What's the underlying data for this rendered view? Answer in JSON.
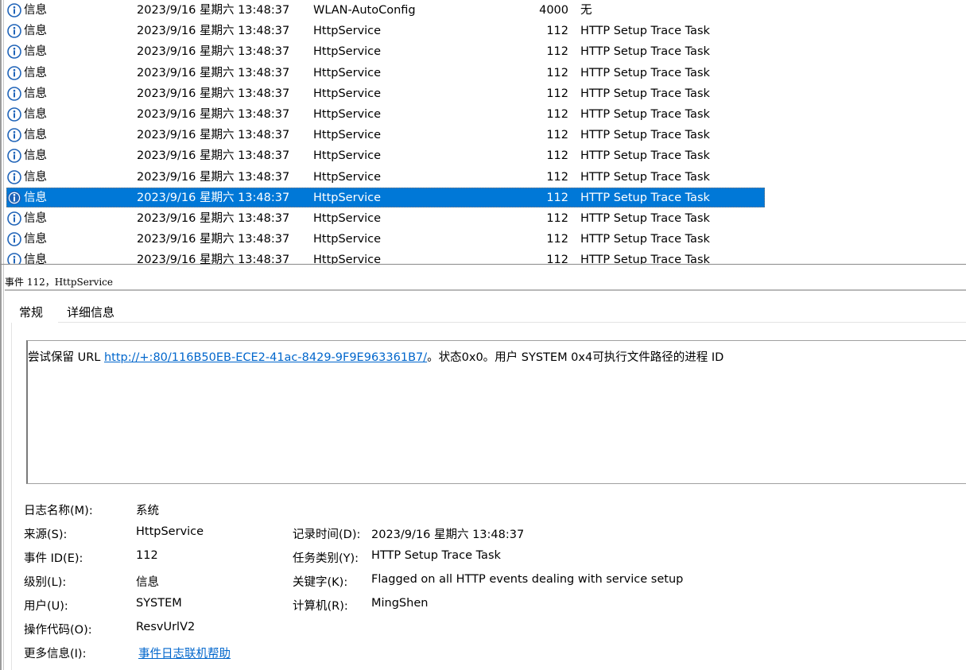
{
  "events": [
    {
      "level": "信息",
      "date": "2023/9/16 星期六 13:48:37",
      "source": "WLAN-AutoConfig",
      "event_id": "4000",
      "task": "无",
      "selected": false
    },
    {
      "level": "信息",
      "date": "2023/9/16 星期六 13:48:37",
      "source": "HttpService",
      "event_id": "112",
      "task": "HTTP Setup Trace Task",
      "selected": false
    },
    {
      "level": "信息",
      "date": "2023/9/16 星期六 13:48:37",
      "source": "HttpService",
      "event_id": "112",
      "task": "HTTP Setup Trace Task",
      "selected": false
    },
    {
      "level": "信息",
      "date": "2023/9/16 星期六 13:48:37",
      "source": "HttpService",
      "event_id": "112",
      "task": "HTTP Setup Trace Task",
      "selected": false
    },
    {
      "level": "信息",
      "date": "2023/9/16 星期六 13:48:37",
      "source": "HttpService",
      "event_id": "112",
      "task": "HTTP Setup Trace Task",
      "selected": false
    },
    {
      "level": "信息",
      "date": "2023/9/16 星期六 13:48:37",
      "source": "HttpService",
      "event_id": "112",
      "task": "HTTP Setup Trace Task",
      "selected": false
    },
    {
      "level": "信息",
      "date": "2023/9/16 星期六 13:48:37",
      "source": "HttpService",
      "event_id": "112",
      "task": "HTTP Setup Trace Task",
      "selected": false
    },
    {
      "level": "信息",
      "date": "2023/9/16 星期六 13:48:37",
      "source": "HttpService",
      "event_id": "112",
      "task": "HTTP Setup Trace Task",
      "selected": false
    },
    {
      "level": "信息",
      "date": "2023/9/16 星期六 13:48:37",
      "source": "HttpService",
      "event_id": "112",
      "task": "HTTP Setup Trace Task",
      "selected": false
    },
    {
      "level": "信息",
      "date": "2023/9/16 星期六 13:48:37",
      "source": "HttpService",
      "event_id": "112",
      "task": "HTTP Setup Trace Task",
      "selected": true
    },
    {
      "level": "信息",
      "date": "2023/9/16 星期六 13:48:37",
      "source": "HttpService",
      "event_id": "112",
      "task": "HTTP Setup Trace Task",
      "selected": false
    },
    {
      "level": "信息",
      "date": "2023/9/16 星期六 13:48:37",
      "source": "HttpService",
      "event_id": "112",
      "task": "HTTP Setup Trace Task",
      "selected": false
    },
    {
      "level": "信息",
      "date": "2023/9/16 星期六 13:48:37",
      "source": "HttpService",
      "event_id": "112",
      "task": "HTTP Setup Trace Task",
      "selected": false
    }
  ],
  "icons": {
    "row_icon": "info-icon"
  },
  "colors": {
    "selection": "#0078d7",
    "link": "#0066cc",
    "info_icon": "#1e63b8"
  },
  "detail": {
    "title": "事件 112，HttpService",
    "tabs": {
      "general": "常规",
      "details": "详细信息"
    },
    "description": {
      "prefix": "尝试保留 URL ",
      "url": "http://+:80/116B50EB-ECE2-41ac-8429-9F9E963361B7/",
      "suffix": "。状态0x0。用户 SYSTEM 0x4可执行文件路径的进程 ID"
    },
    "properties": {
      "log_name_label": "日志名称(M):",
      "log_name": "系统",
      "source_label": "来源(S):",
      "source": "HttpService",
      "logged_label": "记录时间(D):",
      "logged": "2023/9/16 星期六 13:48:37",
      "event_id_label": "事件 ID(E):",
      "event_id": "112",
      "task_category_label": "任务类别(Y):",
      "task_category": "HTTP Setup Trace Task",
      "level_label": "级别(L):",
      "level": "信息",
      "keywords_label": "关键字(K):",
      "keywords": "Flagged on all HTTP events dealing with service setup",
      "user_label": "用户(U):",
      "user": "SYSTEM",
      "computer_label": "计算机(R):",
      "computer": "MingShen",
      "opcode_label": "操作代码(O):",
      "opcode": "ResvUrlV2",
      "more_info_label": "更多信息(I):",
      "more_info_link": "事件日志联机帮助"
    }
  }
}
